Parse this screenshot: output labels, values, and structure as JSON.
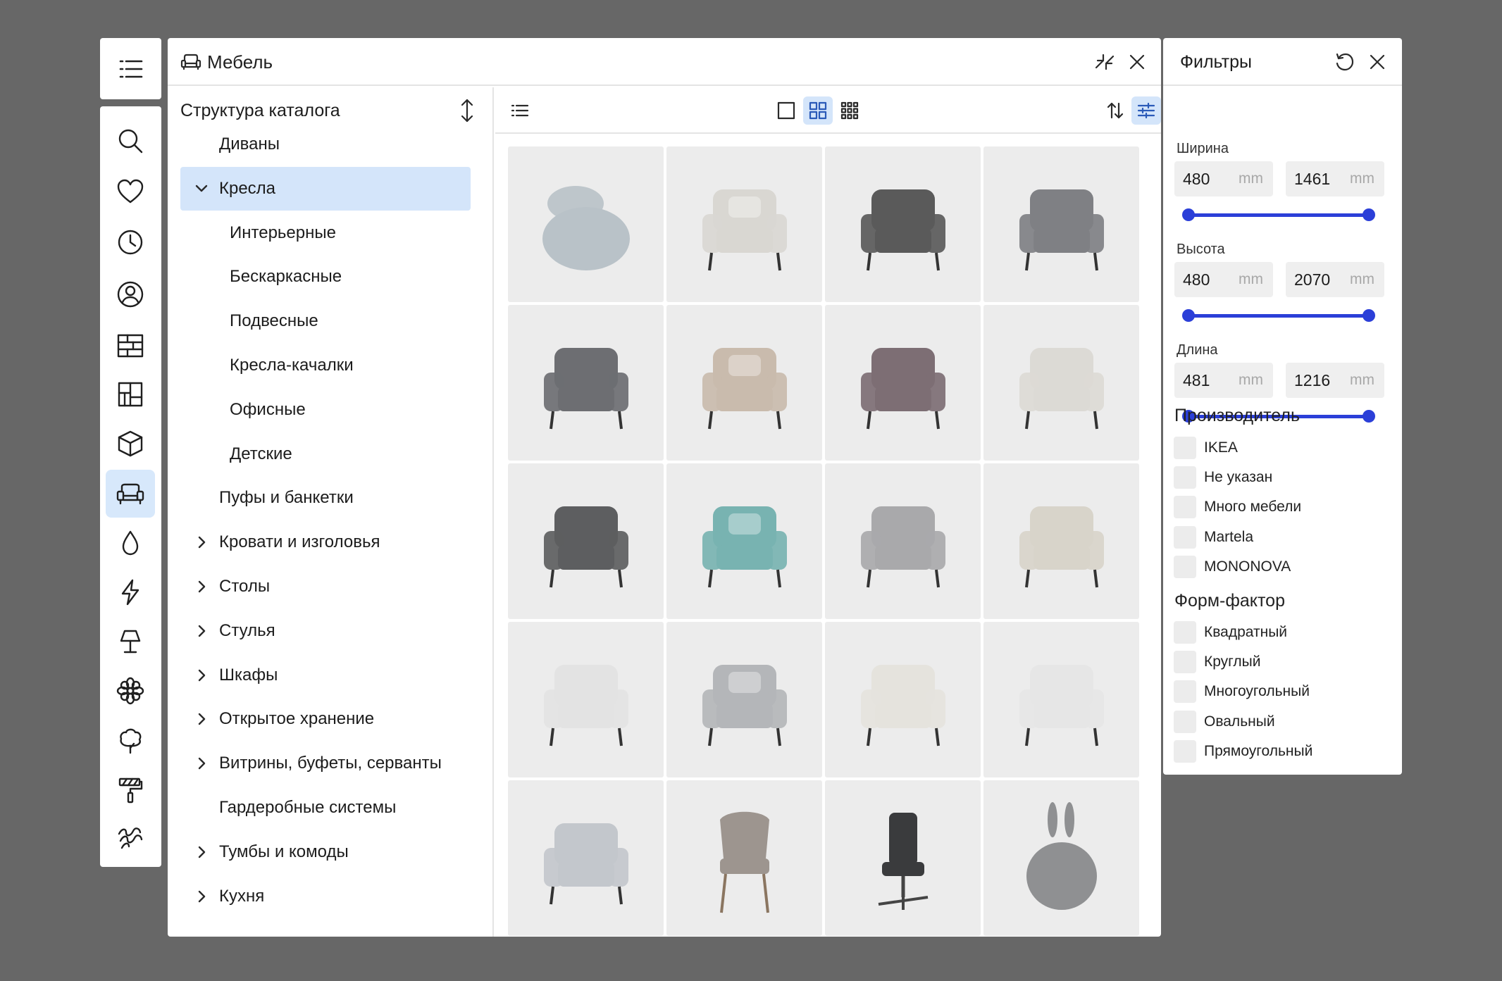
{
  "window": {
    "title": "Мебель"
  },
  "tree": {
    "header": "Структура каталога",
    "items": [
      {
        "label": "Диваны",
        "chevron": "none",
        "level": 0,
        "selected": false
      },
      {
        "label": "Кресла",
        "chevron": "down",
        "level": 0,
        "selected": true
      },
      {
        "label": "Интерьерные",
        "chevron": "none",
        "level": 1,
        "selected": false
      },
      {
        "label": "Бескаркасные",
        "chevron": "none",
        "level": 1,
        "selected": false
      },
      {
        "label": "Подвесные",
        "chevron": "none",
        "level": 1,
        "selected": false
      },
      {
        "label": "Кресла-качалки",
        "chevron": "none",
        "level": 1,
        "selected": false
      },
      {
        "label": "Офисные",
        "chevron": "none",
        "level": 1,
        "selected": false
      },
      {
        "label": "Детские",
        "chevron": "none",
        "level": 1,
        "selected": false
      },
      {
        "label": "Пуфы и банкетки",
        "chevron": "none",
        "level": 0,
        "selected": false
      },
      {
        "label": "Кровати и изголовья",
        "chevron": "right",
        "level": 0,
        "selected": false
      },
      {
        "label": "Столы",
        "chevron": "right",
        "level": 0,
        "selected": false
      },
      {
        "label": "Стулья",
        "chevron": "right",
        "level": 0,
        "selected": false
      },
      {
        "label": "Шкафы",
        "chevron": "right",
        "level": 0,
        "selected": false
      },
      {
        "label": "Открытое хранение",
        "chevron": "right",
        "level": 0,
        "selected": false
      },
      {
        "label": "Витрины, буфеты, серванты",
        "chevron": "right",
        "level": 0,
        "selected": false
      },
      {
        "label": "Гардеробные системы",
        "chevron": "none",
        "level": 0,
        "selected": false
      },
      {
        "label": "Тумбы и комоды",
        "chevron": "right",
        "level": 0,
        "selected": false
      },
      {
        "label": "Кухня",
        "chevron": "right",
        "level": 0,
        "selected": false
      }
    ]
  },
  "rail": {
    "icons": [
      "search-icon",
      "heart-icon",
      "clock-icon",
      "user-icon",
      "wall-icon",
      "plan-icon",
      "cube-icon",
      "armchair-icon",
      "drop-icon",
      "lightning-icon",
      "lamp-icon",
      "flower-icon",
      "tree-icon",
      "paint-roller-icon",
      "texture-icon"
    ],
    "active": "armchair-icon"
  },
  "products": [
    {
      "name": "round-swivel-armchair",
      "color": "#b9c2c8"
    },
    {
      "name": "curved-armchair",
      "color": "#d9d7d2"
    },
    {
      "name": "dark-box-armchair",
      "color": "#5a5a5a"
    },
    {
      "name": "gray-sofa-armchair",
      "color": "#7f8084"
    },
    {
      "name": "gray-lounge-chair",
      "color": "#6d6e72"
    },
    {
      "name": "beige-armchair",
      "color": "#c9bbad"
    },
    {
      "name": "mauve-armchair",
      "color": "#7d6e74"
    },
    {
      "name": "white-swivel-chair",
      "color": "#dcdad5"
    },
    {
      "name": "poang-rocking-chair",
      "color": "#5d5e60"
    },
    {
      "name": "teal-armchair",
      "color": "#78b3b1"
    },
    {
      "name": "metal-frame-armchair",
      "color": "#a9a9ab"
    },
    {
      "name": "tufted-green-armchair",
      "color": "#d8d4ca"
    },
    {
      "name": "woven-rope-chair",
      "color": "#e3e3e3"
    },
    {
      "name": "tufted-gray-armchair",
      "color": "#b4b6b9"
    },
    {
      "name": "gold-frame-chair",
      "color": "#e5e3dd"
    },
    {
      "name": "black-leg-armchair",
      "color": "#e6e6e6"
    },
    {
      "name": "gray-round-chair",
      "color": "#c3c7cc"
    },
    {
      "name": "dining-chair",
      "color": "#9d958f"
    },
    {
      "name": "office-chair",
      "color": "#3a3b3d"
    },
    {
      "name": "bunny-beanbag",
      "color": "#8f9092"
    }
  ],
  "filters": {
    "title": "Фильтры",
    "ranges": [
      {
        "label": "Ширина",
        "min": "480",
        "max": "1461",
        "unit": "mm",
        "lo": 0.0,
        "hi": 1.0
      },
      {
        "label": "Высота",
        "min": "480",
        "max": "2070",
        "unit": "mm",
        "lo": 0.0,
        "hi": 1.0
      },
      {
        "label": "Длина",
        "min": "481",
        "max": "1216",
        "unit": "mm",
        "lo": 0.0,
        "hi": 1.0
      }
    ],
    "manufacturer_title": "Производитель",
    "manufacturers": [
      "IKEA",
      "Не указан",
      "Много мебели",
      "Martela",
      "MONONOVA"
    ],
    "form_title": "Форм-фактор",
    "forms": [
      "Квадратный",
      "Круглый",
      "Многоугольный",
      "Овальный",
      "Прямоугольный"
    ]
  }
}
